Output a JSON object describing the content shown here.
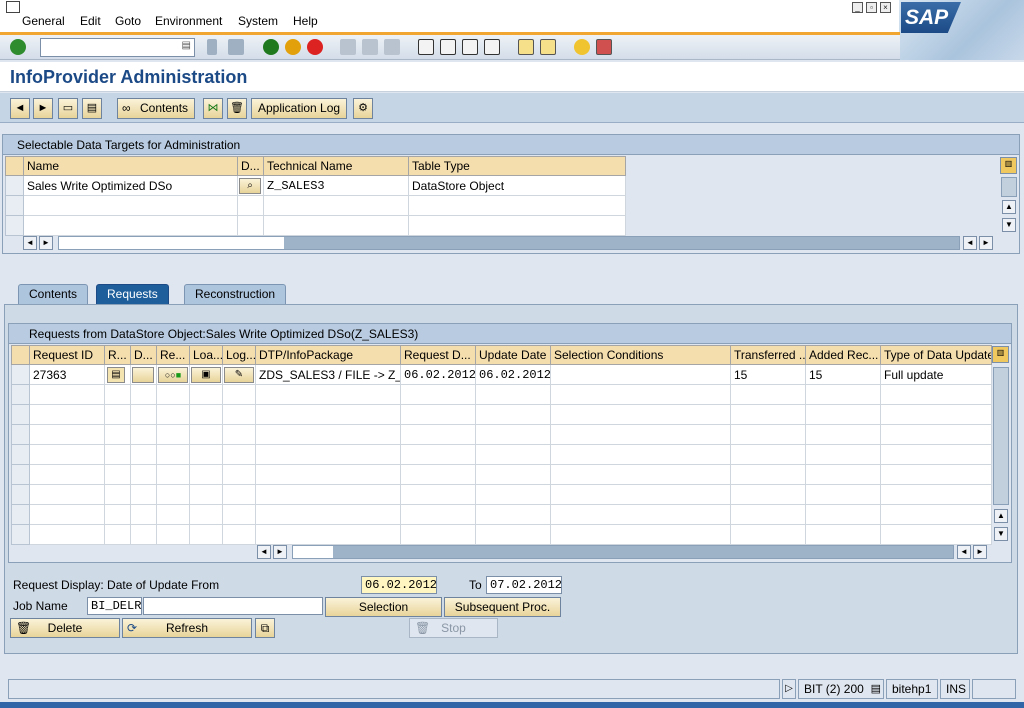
{
  "menu": {
    "items": [
      "General",
      "Edit",
      "Goto",
      "Environment",
      "System",
      "Help"
    ]
  },
  "window_controls": [
    "minimize-icon",
    "restore-icon",
    "close-icon"
  ],
  "logo": {
    "text": "SAP"
  },
  "command_field": {
    "value": ""
  },
  "title": "InfoProvider Administration",
  "app_toolbar": {
    "contents_label": "Contents",
    "app_log_label": "Application Log"
  },
  "targets": {
    "header": "Selectable Data Targets for Administration",
    "columns": [
      "Name",
      "D...",
      "Technical Name",
      "Table Type"
    ],
    "rows": [
      {
        "name": "Sales Write Optimized DSo",
        "tech": "Z_SALES3",
        "type": "DataStore Object"
      }
    ]
  },
  "tabs": [
    "Contents",
    "Requests",
    "Reconstruction"
  ],
  "active_tab": "Requests",
  "requests": {
    "header": "Requests from DataStore Object:Sales Write Optimized DSo(Z_SALES3)",
    "columns": [
      "Request ID",
      "R...",
      "D...",
      "Re...",
      "Loa...",
      "Log...",
      "DTP/InfoPackage",
      "Request D...",
      "Update Date",
      "Selection Conditions",
      "Transferred ...",
      "Added Rec...",
      "Type of Data Update"
    ],
    "rows": [
      {
        "id": "27363",
        "dtp": "ZDS_SALES3 / FILE -> Z_S",
        "req_date": "06.02.2012",
        "upd_date": "06.02.2012",
        "sel": "",
        "transferred": "15",
        "added": "15",
        "type": "Full update"
      }
    ]
  },
  "form": {
    "date_from_label": "Request Display: Date of Update From",
    "date_from": "06.02.2012",
    "to_label": "To",
    "date_to": "07.02.2012",
    "job_label": "Job Name",
    "job_value": "BI_DELR",
    "selection_label": "Selection",
    "subsequent_label": "Subsequent Proc.",
    "delete_label": "Delete",
    "refresh_label": "Refresh",
    "stop_label": "Stop"
  },
  "status": {
    "system": "BIT (2) 200",
    "host": "bitehp1",
    "mode": "INS"
  }
}
